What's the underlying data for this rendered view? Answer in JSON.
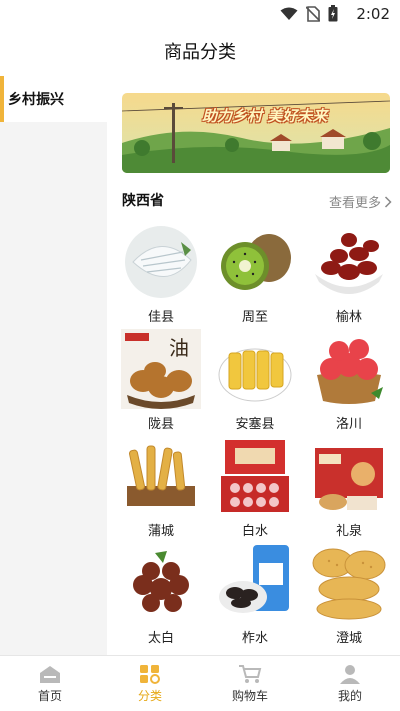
{
  "status": {
    "time": "2:02"
  },
  "header": {
    "title": "商品分类"
  },
  "sidebar": {
    "items": [
      {
        "label": "乡村振兴",
        "active": true
      }
    ]
  },
  "banner": {
    "text": "助力乡村  美好未来"
  },
  "section": {
    "province": "陕西省",
    "more_label": "查看更多"
  },
  "products": [
    {
      "name": "佳县",
      "icon": "vermicelli"
    },
    {
      "name": "周至",
      "icon": "kiwi"
    },
    {
      "name": "榆林",
      "icon": "red-dates"
    },
    {
      "name": "陇县",
      "icon": "fried-pastry"
    },
    {
      "name": "安塞县",
      "icon": "yellow-cake"
    },
    {
      "name": "洛川",
      "icon": "apples"
    },
    {
      "name": "蒲城",
      "icon": "crispy-sticks"
    },
    {
      "name": "白水",
      "icon": "apple-gift-box"
    },
    {
      "name": "礼泉",
      "icon": "gift-box"
    },
    {
      "name": "太白",
      "icon": "chestnuts"
    },
    {
      "name": "柞水",
      "icon": "black-fungus"
    },
    {
      "name": "澄城",
      "icon": "flatbread"
    }
  ],
  "tabbar": {
    "items": [
      {
        "label": "首页",
        "icon": "home-icon"
      },
      {
        "label": "分类",
        "icon": "category-icon",
        "active": true
      },
      {
        "label": "购物车",
        "icon": "cart-icon"
      },
      {
        "label": "我的",
        "icon": "profile-icon"
      }
    ]
  },
  "colors": {
    "accent": "#f0b43a",
    "active_tab": "#e6a817",
    "sidebar_bg": "#f4f4f4"
  }
}
